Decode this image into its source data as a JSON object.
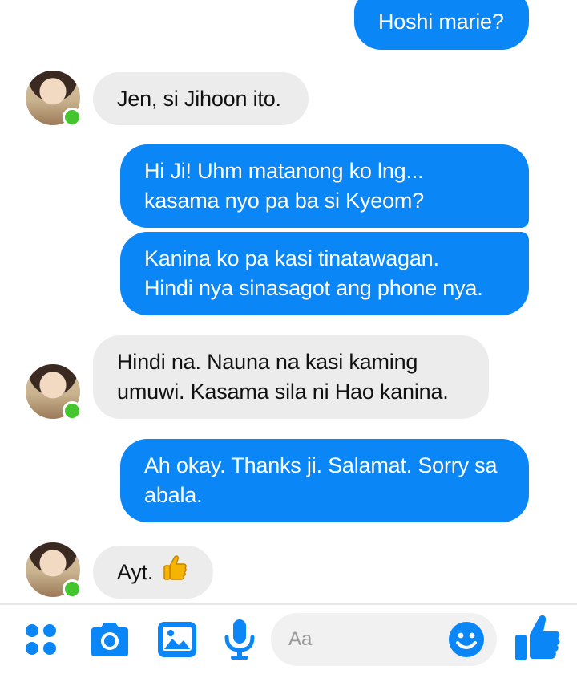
{
  "conversation": {
    "messages": [
      {
        "from": "me",
        "text": "Hoshi marie?"
      },
      {
        "from": "jihoon",
        "text": "Jen, si Jihoon ito."
      },
      {
        "from": "me",
        "text_lines": [
          "Hi Ji! Uhm matanong ko lng...",
          "kasama nyo pa ba si Kyeom?"
        ]
      },
      {
        "from": "me",
        "text_lines": [
          "Kanina ko pa kasi tinatawagan.",
          "Hindi nya sinasagot ang phone nya."
        ]
      },
      {
        "from": "jihoon",
        "text_lines": [
          "Hindi na. Nauna na kasi kaming",
          "umuwi. Kasama sila ni Hao kanina."
        ]
      },
      {
        "from": "me",
        "text_lines": [
          "Ah okay. Thanks ji. Salamat. Sorry sa",
          "abala."
        ]
      },
      {
        "from": "jihoon",
        "text": "Ayt.",
        "emoji": "thumbs-up-emoji"
      }
    ]
  },
  "composer": {
    "placeholder": "Aa",
    "tools": [
      "apps-icon",
      "camera-icon",
      "gallery-icon",
      "microphone-icon"
    ],
    "emoji_icon": "smiley-icon",
    "send_icon": "like-thumb-icon"
  },
  "colors": {
    "outgoing_bubble": "#0a86f6",
    "incoming_bubble": "#ececec",
    "accent": "#0a86f6",
    "online_dot": "#44c52e"
  }
}
